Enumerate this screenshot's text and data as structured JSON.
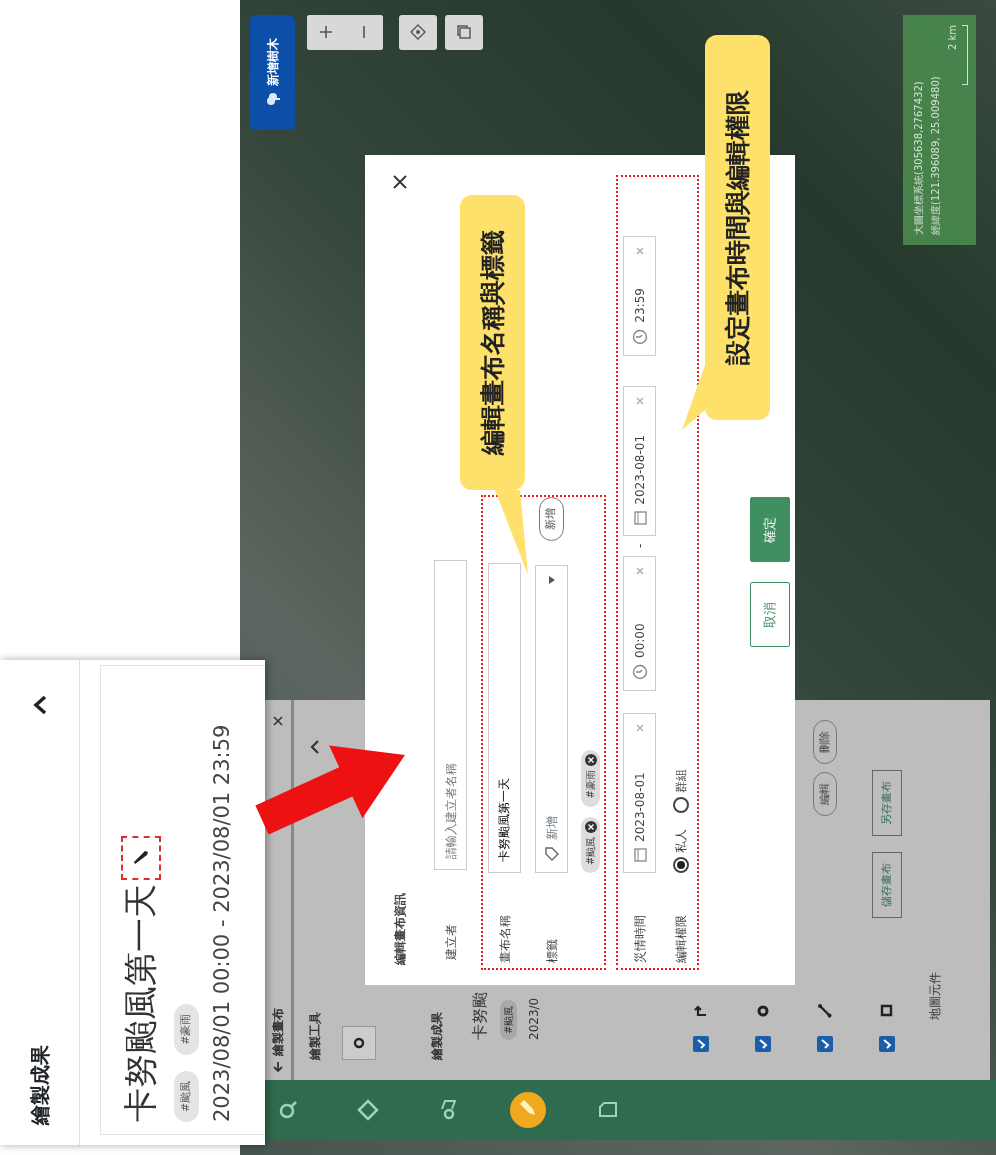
{
  "side_nav": {
    "items": [
      {
        "kind": "search",
        "selected": false
      },
      {
        "kind": "layers",
        "selected": false
      },
      {
        "kind": "pins",
        "selected": false
      },
      {
        "kind": "draw",
        "selected": true
      },
      {
        "kind": "document",
        "selected": false
      }
    ]
  },
  "map": {
    "add_tree_button": "新增樹木",
    "scale": {
      "lines": [
        "大圖坐標系統(305638,2767432)",
        "經緯度(121.396089, 25.009480)"
      ],
      "distance": "2 km"
    }
  },
  "panel": {
    "title": "繪製畫布",
    "tools_label": "繪製工具",
    "results_label": "繪製成果",
    "result": {
      "name": "卡努颱",
      "tag": "#颱風",
      "date": "2023/0"
    },
    "layers": [
      {
        "kind": "route",
        "checked": true
      },
      {
        "kind": "point",
        "checked": true
      },
      {
        "kind": "line",
        "checked": true
      },
      {
        "kind": "polygon",
        "checked": true
      }
    ],
    "actions": [
      "編輯",
      "刪除"
    ],
    "save_buttons": [
      "儲存畫布",
      "另存畫布"
    ],
    "footer": "地圖元件"
  },
  "dialog": {
    "title": "編輯畫布資訊",
    "creator": {
      "label": "建立者",
      "placeholder": "請輸入建立者名稱"
    },
    "name": {
      "label": "畫布名稱",
      "value": "卡努颱風第一天"
    },
    "tags": {
      "label": "標籤",
      "placeholder": "新增",
      "add_button": "新增",
      "chips": [
        "#颱風",
        "#豪雨"
      ]
    },
    "time": {
      "label": "災情時間",
      "start_date": "2023-08-01",
      "start_time": "00:00",
      "separator": "-",
      "end_date": "2023-08-01",
      "end_time": "23:59"
    },
    "permission": {
      "label": "編輯權限",
      "options": [
        {
          "label": "私人",
          "selected": true
        },
        {
          "label": "群組",
          "selected": false
        }
      ]
    },
    "buttons": [
      {
        "kind": "secondary",
        "label": "取消"
      },
      {
        "kind": "primary",
        "label": "確定"
      }
    ]
  },
  "callouts": [
    "編輯畫布名稱與標籤",
    "設定畫布時間與編輯權限"
  ],
  "inset": {
    "title": "繪製成果",
    "card": {
      "name": "卡努颱風第一天",
      "tags": [
        "#颱風",
        "#豪雨"
      ],
      "date": "2023/08/01 00:00 - 2023/08/01 23:59"
    }
  }
}
